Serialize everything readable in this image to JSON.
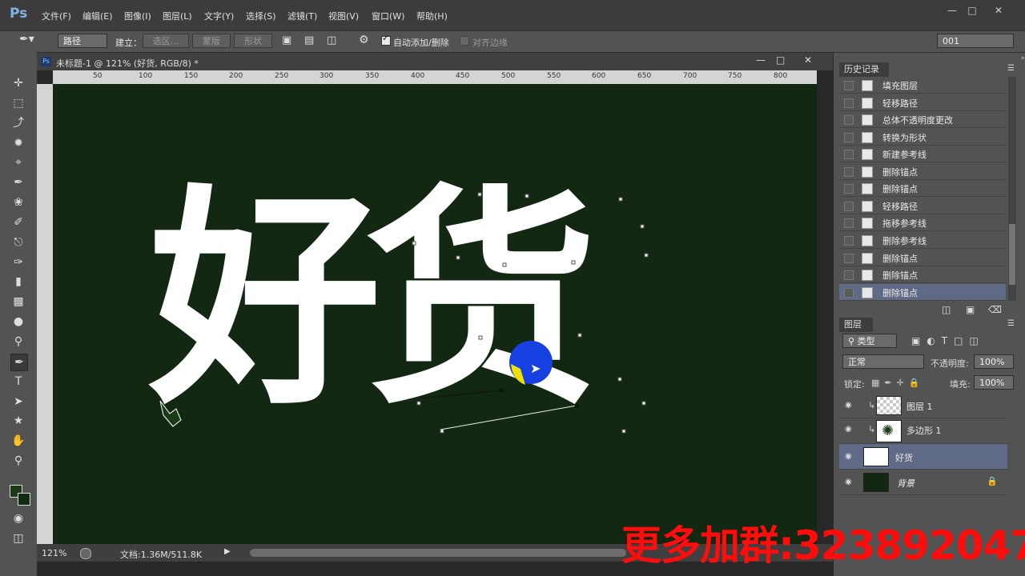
{
  "app": {
    "logo": "Ps"
  },
  "menu": [
    "文件(F)",
    "编辑(E)",
    "图像(I)",
    "图层(L)",
    "文字(Y)",
    "选择(S)",
    "滤镜(T)",
    "视图(V)",
    "窗口(W)",
    "帮助(H)"
  ],
  "options": {
    "mode_select": "路径",
    "make_label": "建立：",
    "selection_btn": "选区...",
    "mask_btn": "蒙版",
    "shape_btn": "形状",
    "auto_add_delete": "自动添加/删除",
    "align_edges": "对齐边缘",
    "preset": "001"
  },
  "document": {
    "title": "未标题-1 @ 121% (好货, RGB/8) *",
    "ruler_ticks": [
      "50",
      "100",
      "150",
      "200",
      "250",
      "300",
      "350",
      "400",
      "450",
      "500",
      "550",
      "600",
      "650",
      "700",
      "750",
      "800"
    ],
    "canvas_text": "好货",
    "zoom": "121%",
    "doc_size": "文档:1.36M/511.8K"
  },
  "history": {
    "title": "历史记录",
    "items": [
      "填充图层",
      "轻移路径",
      "总体不透明度更改",
      "转换为形状",
      "新建参考线",
      "删除锚点",
      "删除锚点",
      "轻移路径",
      "拖移参考线",
      "删除参考线",
      "删除锚点",
      "删除锚点",
      "删除锚点"
    ]
  },
  "layers": {
    "title": "图层",
    "filter": "类型",
    "blend_mode": "正常",
    "opacity_label": "不透明度:",
    "opacity": "100%",
    "lock_label": "锁定:",
    "fill_label": "填充:",
    "fill": "100%",
    "items": [
      {
        "name": "图层 1"
      },
      {
        "name": "多边形 1"
      },
      {
        "name": "好货"
      },
      {
        "name": "背景"
      }
    ]
  },
  "watermark": "更多加群:323892047",
  "colors": {
    "canvas_bg": "#132812",
    "active_row": "#5f6b86",
    "watermark": "#ff0c0c"
  }
}
